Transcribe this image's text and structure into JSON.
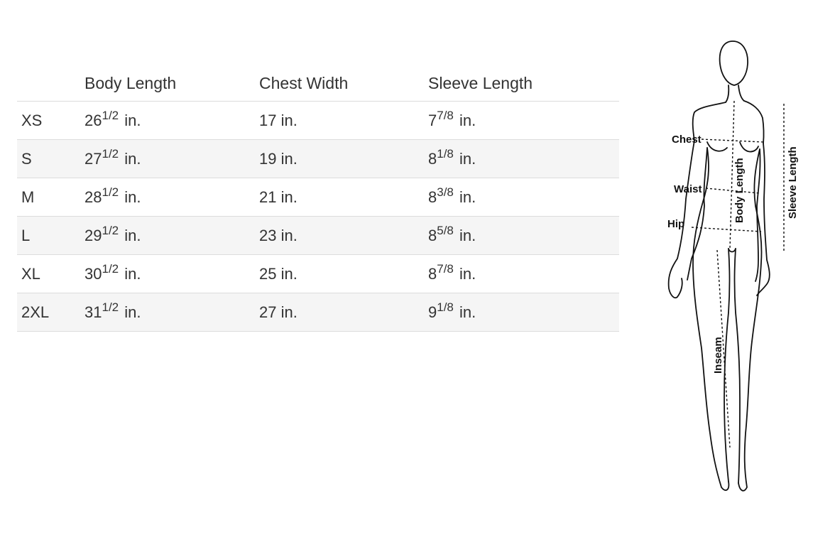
{
  "table": {
    "headers": [
      "",
      "Body Length",
      "Chest Width",
      "Sleeve Length"
    ],
    "rows": [
      {
        "size": "XS",
        "body_whole": "26",
        "body_frac": "1/2",
        "chest": "17 in.",
        "sleeve_whole": "7",
        "sleeve_frac": "7/8"
      },
      {
        "size": "S",
        "body_whole": "27",
        "body_frac": "1/2",
        "chest": "19 in.",
        "sleeve_whole": "8",
        "sleeve_frac": "1/8"
      },
      {
        "size": "M",
        "body_whole": "28",
        "body_frac": "1/2",
        "chest": "21 in.",
        "sleeve_whole": "8",
        "sleeve_frac": "3/8"
      },
      {
        "size": "L",
        "body_whole": "29",
        "body_frac": "1/2",
        "chest": "23 in.",
        "sleeve_whole": "8",
        "sleeve_frac": "5/8"
      },
      {
        "size": "XL",
        "body_whole": "30",
        "body_frac": "1/2",
        "chest": "25 in.",
        "sleeve_whole": "8",
        "sleeve_frac": "7/8"
      },
      {
        "size": "2XL",
        "body_whole": "31",
        "body_frac": "1/2",
        "chest": "27 in.",
        "sleeve_whole": "9",
        "sleeve_frac": "1/8"
      }
    ],
    "unit_suffix": "in."
  },
  "figure": {
    "labels": {
      "chest": "Chest",
      "waist": "Waist",
      "hip": "Hip",
      "body_length": "Body Length",
      "sleeve_length": "Sleeve Length",
      "inseam": "Inseam"
    }
  },
  "colors": {
    "text": "#333333",
    "row_alt_bg": "#f5f5f5",
    "divider": "#dcdcdc"
  }
}
